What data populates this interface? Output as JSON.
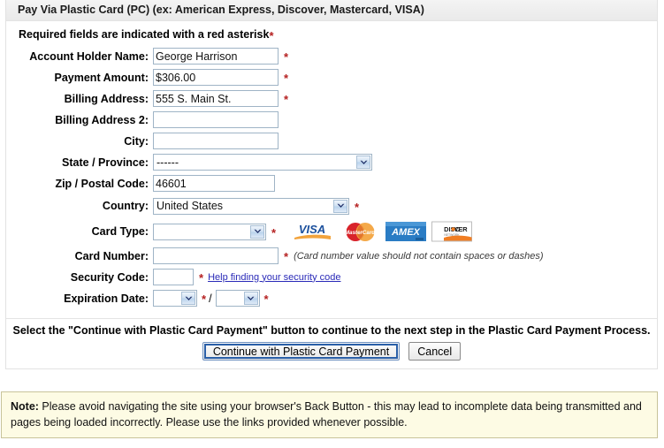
{
  "panel": {
    "header_title": "Pay Via Plastic Card (PC) (ex: American Express, Discover, Mastercard, VISA)",
    "required_note": "Required fields are indicated with a red asterisk",
    "asterisk": "*"
  },
  "fields": {
    "account_holder_name": {
      "label": "Account Holder Name:",
      "value": "George Harrison",
      "placeholder": "",
      "required": true
    },
    "payment_amount": {
      "label": "Payment Amount:",
      "value": "$306.00",
      "placeholder": "",
      "required": true
    },
    "billing_address": {
      "label": "Billing Address:",
      "value": "555 S. Main St.",
      "placeholder": "",
      "required": true
    },
    "billing_address_2": {
      "label": "Billing Address 2:",
      "value": "",
      "placeholder": "",
      "required": false
    },
    "city": {
      "label": "City:",
      "value": "",
      "placeholder": "",
      "required": false
    },
    "state_province": {
      "label": "State / Province:",
      "value": "------",
      "required": false
    },
    "zip_postal_code": {
      "label": "Zip / Postal Code:",
      "value": "46601",
      "placeholder": "",
      "required": false
    },
    "country": {
      "label": "Country:",
      "value": "United States",
      "required": true
    },
    "card_type": {
      "label": "Card Type:",
      "value": "",
      "required": true
    },
    "card_number": {
      "label": "Card Number:",
      "value": "",
      "placeholder": "",
      "required": true,
      "hint": "(Card number value should not contain spaces or dashes)"
    },
    "security_code": {
      "label": "Security Code:",
      "value": "",
      "placeholder": "",
      "required": true,
      "help_link": "Help finding your security code"
    },
    "expiration_date": {
      "label": "Expiration Date:",
      "month_value": "",
      "year_value": "",
      "separator": "/",
      "required": true
    }
  },
  "card_logos": [
    {
      "name": "visa-logo",
      "text": "VISA"
    },
    {
      "name": "mastercard-logo",
      "text": "MasterCard"
    },
    {
      "name": "amex-logo",
      "text": "AMEX"
    },
    {
      "name": "discover-logo",
      "text": "DISCOVER"
    }
  ],
  "footer": {
    "instruction": "Select the \"Continue with Plastic Card Payment\" button to continue to the next step in the Plastic Card Payment Process.",
    "continue_button": "Continue with Plastic Card Payment",
    "cancel_button": "Cancel"
  },
  "note": {
    "prefix": "Note:",
    "text": " Please avoid navigating the site using your browser's Back Button - this may lead to incomplete data being transmitted and pages being loaded incorrectly. Please use the links provided whenever possible."
  },
  "colors": {
    "asterisk_red": "#b52020",
    "link_blue": "#2a2ab8",
    "note_bg": "#fdfbe4",
    "note_border": "#c8c39a",
    "input_border": "#9fb4c6",
    "header_bg": "#eeeeee"
  }
}
